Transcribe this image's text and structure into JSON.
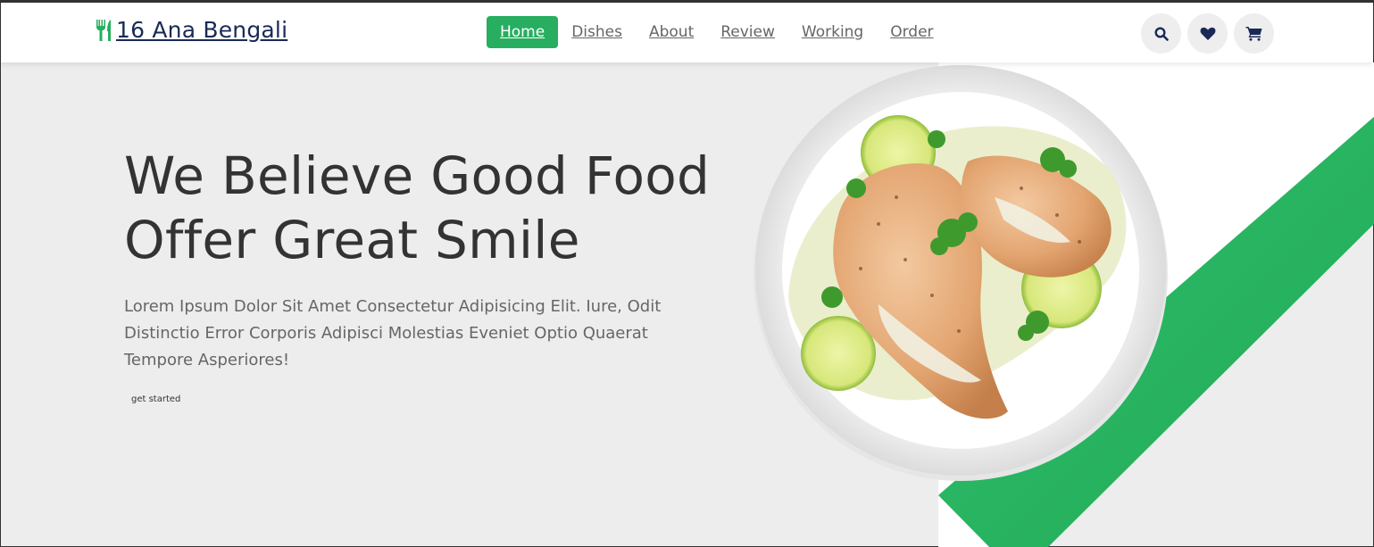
{
  "header": {
    "logo_text": "16 Ana Bengali",
    "logo_icon": "utensils-icon",
    "nav": [
      {
        "label": "Home",
        "active": true
      },
      {
        "label": "Dishes",
        "active": false
      },
      {
        "label": "About",
        "active": false
      },
      {
        "label": "Review",
        "active": false
      },
      {
        "label": "Working",
        "active": false
      },
      {
        "label": "Order",
        "active": false
      }
    ],
    "icons": [
      "search-icon",
      "heart-icon",
      "cart-icon"
    ]
  },
  "hero": {
    "title_line1": "We Believe Good Food",
    "title_line2": "Offer Great Smile",
    "description": "Lorem Ipsum Dolor Sit Amet Consectetur Adipisicing Elit. Iure, Odit Distinctio Error Corporis Adipisci Molestias Eveniet Optio Quaerat Tempore Asperiores!",
    "button_label": "get started"
  },
  "colors": {
    "accent": "#27ae60",
    "brand_text": "#192a56",
    "background": "#ededed",
    "heading": "#333333",
    "body_text": "#666666"
  }
}
